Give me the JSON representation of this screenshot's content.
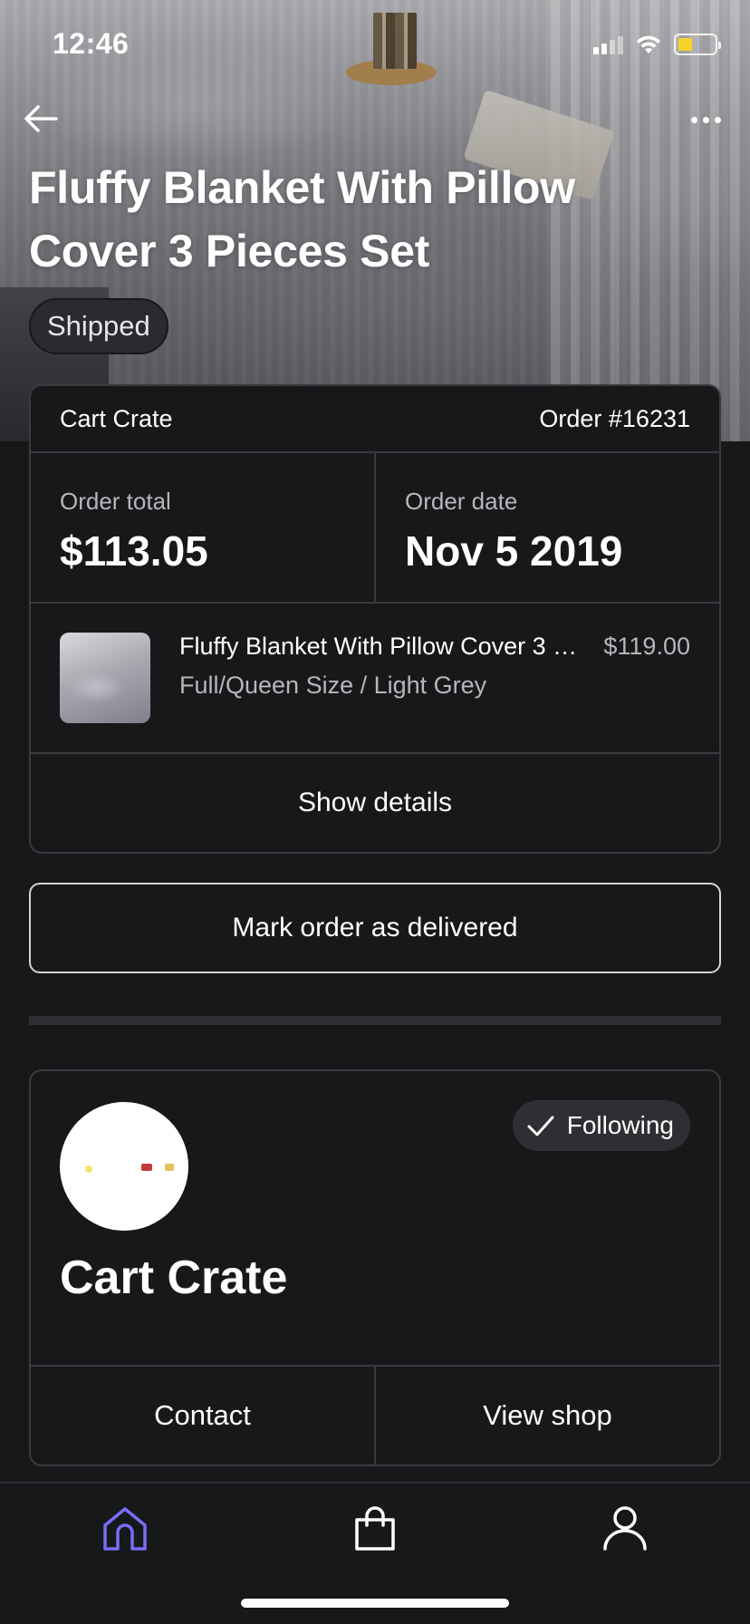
{
  "status_bar": {
    "time": "12:46",
    "battery_level": 0.4,
    "battery_color": "#f5d328"
  },
  "header": {
    "title": "Fluffy Blanket With Pillow Cover 3 Pieces Set",
    "status": "Shipped",
    "back_icon": "arrow-left-icon",
    "more_icon": "more-horizontal-icon"
  },
  "order": {
    "shop_name": "Cart Crate",
    "order_number": "Order #16231",
    "total_label": "Order total",
    "total_value": "$113.05",
    "date_label": "Order date",
    "date_value": "Nov 5 2019",
    "item": {
      "name": "Fluffy Blanket With Pillow Cover 3 Pieces Set",
      "price": "$119.00",
      "variant": "Full/Queen Size / Light Grey"
    },
    "show_details_label": "Show details"
  },
  "actions": {
    "mark_delivered_label": "Mark order as delivered"
  },
  "shop": {
    "name": "Cart Crate",
    "following_label": "Following",
    "contact_label": "Contact",
    "view_shop_label": "View shop"
  },
  "tab_bar": {
    "tabs": [
      {
        "icon": "home-icon",
        "active": true
      },
      {
        "icon": "shopping-bag-icon",
        "active": false
      },
      {
        "icon": "user-icon",
        "active": false
      }
    ],
    "active_color": "#7b6cf6"
  }
}
